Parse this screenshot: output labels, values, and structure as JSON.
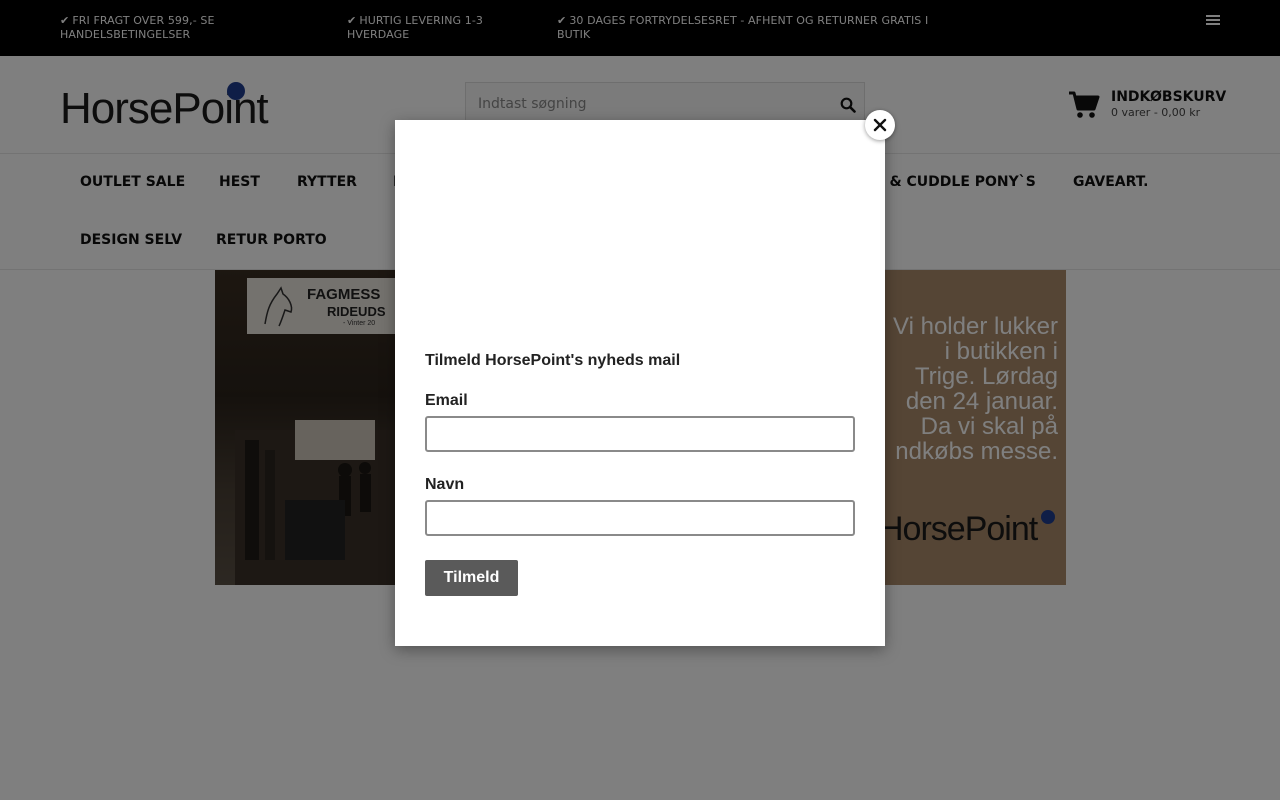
{
  "topbar": {
    "usp1": "FRI FRAGT OVER 599,- SE HANDELSBETINGELSER",
    "usp2": "HURTIG LEVERING 1-3 HVERDAGE",
    "usp3": "30 DAGES FORTRYDELSESRET - AFHENT OG RETURNER GRATIS I BUTIK",
    "check_icon": "check-icon",
    "menu_icon": "hamburger-menu-icon"
  },
  "header": {
    "logo_text": "HorsePoint",
    "search_placeholder": "Indtast søgning",
    "cart_title": "INDKØBSKURV",
    "cart_summary": "0 varer - 0,00 kr"
  },
  "nav": {
    "items": [
      "OUTLET SALE",
      "HEST",
      "RYTTER",
      "R",
      "E & CUDDLE PONY`S",
      "GAVEART.",
      "DESIGN SELV",
      "RETUR PORTO"
    ]
  },
  "banner": {
    "sign_line1": "FAGMESS",
    "sign_line2": "RIDEUDS",
    "sign_line3": "- Vinter 20",
    "message_lines": [
      "Vi holder lukker",
      "i butikken i",
      "Trige. Lørdag",
      "den 24 januar.",
      "Da vi skal på",
      "ndkøbs messe."
    ],
    "logo_text": "HorsePoint"
  },
  "modal": {
    "title": "Tilmeld HorsePoint's nyheds mail",
    "email_label": "Email",
    "email_value": "",
    "name_label": "Navn",
    "name_value": "",
    "submit_label": "Tilmeld",
    "close_icon": "close-icon"
  },
  "colors": {
    "topbar_bg": "#000000",
    "brand_dot": "#1f3c8e",
    "submit_bg": "#5a5a5a",
    "overlay": "rgba(0,0,0,0.5)"
  }
}
